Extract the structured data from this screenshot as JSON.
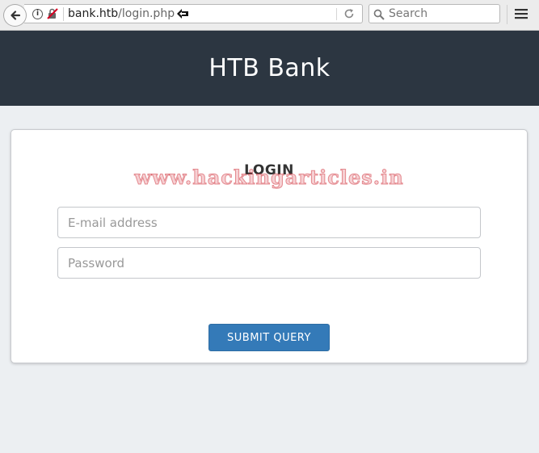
{
  "browser": {
    "url_host": "bank.htb",
    "url_path": "/login.php",
    "search_placeholder": "Search"
  },
  "header": {
    "title": "HTB Bank"
  },
  "login": {
    "title": "LOGIN",
    "watermark": "www.hackingarticles.in",
    "email_placeholder": "E-mail address",
    "password_placeholder": "Password",
    "submit_label": "SUBMIT QUERY"
  },
  "colors": {
    "header_bg": "#2c3641",
    "page_bg": "#eceff2",
    "button_bg": "#347ab8"
  },
  "icons": [
    "back-arrow-icon",
    "info-icon",
    "insecure-lock-icon",
    "cursor-arrow-icon",
    "reload-icon",
    "search-icon",
    "hamburger-menu-icon"
  ]
}
